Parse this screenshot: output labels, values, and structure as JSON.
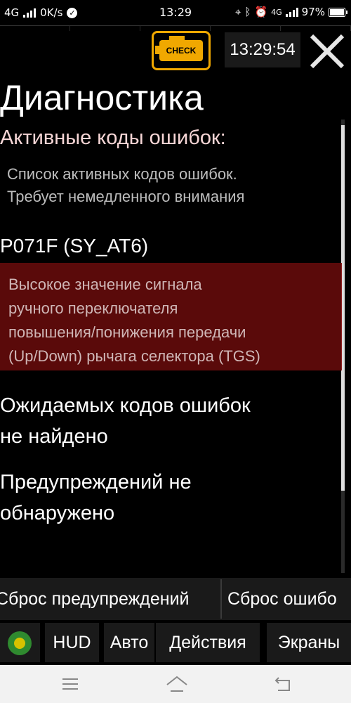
{
  "status_bar": {
    "network": "4G",
    "speed": "0K/s",
    "time": "13:29",
    "network_right": "4G",
    "battery": "97%",
    "icons": [
      "signal-icon",
      "check-circle-icon",
      "location-icon",
      "bluetooth-icon",
      "alarm-icon",
      "signal-icon",
      "battery-icon"
    ]
  },
  "header": {
    "check_engine_label": "CHECK",
    "clock": "13:29:54",
    "close_icon": "close-icon"
  },
  "page": {
    "title": "Диагностика",
    "section_heading": "Активные коды ошибок:",
    "section_desc_line1": "Список активных кодов ошибок.",
    "section_desc_line2": "Требует немедленного внимания"
  },
  "error": {
    "code": "P071F (SY_AT6)",
    "desc_lines": [
      "Высокое значение сигнала",
      "ручного переключателя",
      "повышения/понижения передачи",
      "(Up/Down) рычага селектора (TGS)"
    ],
    "box_color": "#5a0a0a"
  },
  "messages": {
    "expected_line1": "Ожидаемых кодов ошибок",
    "expected_line2": "не найдено",
    "warnings_line1": "Предупреждений не",
    "warnings_line2": "обнаружено"
  },
  "reset_buttons": {
    "reset_warnings": "Сброс предупреждений",
    "reset_errors": "Сброс ошибо"
  },
  "bottom_nav": {
    "hud": "HUD",
    "auto": "Авто",
    "actions": "Действия",
    "screens": "Экраны"
  },
  "colors": {
    "accent_orange": "#f0a800",
    "error_bg": "#5a0a0a",
    "heading_pink": "#f6d6d6"
  }
}
